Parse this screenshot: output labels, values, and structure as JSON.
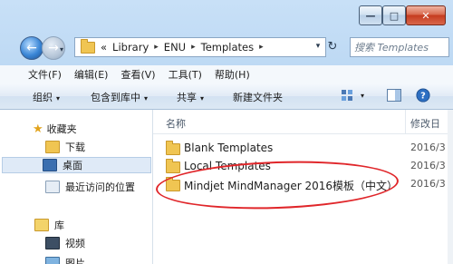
{
  "window": {
    "controls": {
      "minimize": "—",
      "maximize": "□",
      "close": "✕"
    }
  },
  "nav": {
    "back_icon": "back-arrow-icon",
    "forward_icon": "forward-arrow-icon",
    "breadcrumb_prefix": "«",
    "breadcrumbs": [
      "Library",
      "ENU",
      "Templates"
    ],
    "separator": "▸",
    "refresh_icon": "↻",
    "search_placeholder": "搜索 Templates"
  },
  "menu": {
    "items": [
      "文件(F)",
      "编辑(E)",
      "查看(V)",
      "工具(T)",
      "帮助(H)"
    ]
  },
  "toolbar": {
    "organize": "组织",
    "include_library": "包含到库中",
    "share": "共享",
    "new_folder": "新建文件夹",
    "caret": "▾"
  },
  "sidebar": {
    "favorites": "收藏夹",
    "downloads": "下载",
    "desktop": "桌面",
    "recent": "最近访问的位置",
    "libraries": "库",
    "videos": "视频",
    "pictures": "图片"
  },
  "content": {
    "columns": {
      "name": "名称",
      "modified": "修改日"
    },
    "rows": [
      {
        "name": "Blank Templates",
        "date": "2016/3"
      },
      {
        "name": "Local Templates",
        "date": "2016/3"
      },
      {
        "name": "Mindjet MindManager 2016模板（中文）",
        "date": "2016/3"
      }
    ]
  },
  "colors": {
    "highlight": "#e0262a",
    "folder": "#f0c552"
  }
}
